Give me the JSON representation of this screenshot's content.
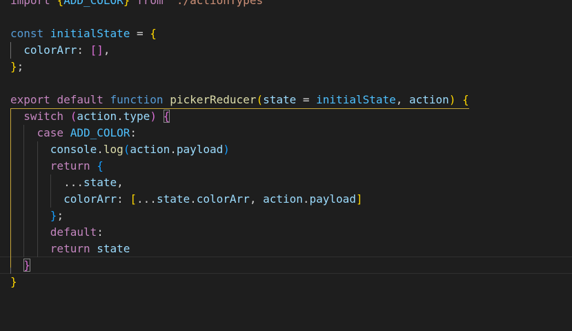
{
  "editor": {
    "colors": {
      "background": "#1e1e1e",
      "keyword_blue": "#569cd6",
      "keyword_purple": "#c586c0",
      "variable": "#9cdcfe",
      "constant": "#4fc1ff",
      "function": "#dcdcaa",
      "string": "#ce9178",
      "bracket_gold": "#ffd700",
      "bracket_orchid": "#da70d6",
      "bracket_blue": "#179fff"
    },
    "lines": [
      {
        "tokens": [
          {
            "t": "import ",
            "c": "kw-purple"
          },
          {
            "t": "{",
            "c": "br1"
          },
          {
            "t": "ADD_COLOR",
            "c": "const"
          },
          {
            "t": "}",
            "c": "br1"
          },
          {
            "t": " from ",
            "c": "kw-purple"
          },
          {
            "t": "'./actionTypes'",
            "c": "str"
          }
        ]
      },
      {
        "tokens": []
      },
      {
        "tokens": [
          {
            "t": "const ",
            "c": "kw-blue"
          },
          {
            "t": "initialState",
            "c": "const"
          },
          {
            "t": " = ",
            "c": "punc"
          },
          {
            "t": "{",
            "c": "br1"
          }
        ]
      },
      {
        "tokens": [
          {
            "t": "  ",
            "c": "punc"
          },
          {
            "t": "colorArr",
            "c": "var"
          },
          {
            "t": ": ",
            "c": "punc"
          },
          {
            "t": "[]",
            "c": "br2"
          },
          {
            "t": ",",
            "c": "punc"
          }
        ]
      },
      {
        "tokens": [
          {
            "t": "}",
            "c": "br1"
          },
          {
            "t": ";",
            "c": "punc"
          }
        ]
      },
      {
        "tokens": []
      },
      {
        "tokens": [
          {
            "t": "export ",
            "c": "kw-purple"
          },
          {
            "t": "default ",
            "c": "kw-purple"
          },
          {
            "t": "function ",
            "c": "kw-blue"
          },
          {
            "t": "pickerReducer",
            "c": "fn"
          },
          {
            "t": "(",
            "c": "br1"
          },
          {
            "t": "state",
            "c": "var"
          },
          {
            "t": " = ",
            "c": "punc"
          },
          {
            "t": "initialState",
            "c": "const"
          },
          {
            "t": ", ",
            "c": "punc"
          },
          {
            "t": "action",
            "c": "var"
          },
          {
            "t": ")",
            "c": "br1"
          },
          {
            "t": " ",
            "c": "punc"
          },
          {
            "t": "{",
            "c": "br1"
          }
        ]
      },
      {
        "tokens": [
          {
            "t": "  ",
            "c": "punc"
          },
          {
            "t": "switch ",
            "c": "kw-purple"
          },
          {
            "t": "(",
            "c": "br2"
          },
          {
            "t": "action",
            "c": "var"
          },
          {
            "t": ".",
            "c": "punc"
          },
          {
            "t": "type",
            "c": "var"
          },
          {
            "t": ")",
            "c": "br2"
          },
          {
            "t": " ",
            "c": "punc"
          },
          {
            "t": "{",
            "c": "br2",
            "match": true
          }
        ]
      },
      {
        "tokens": [
          {
            "t": "    ",
            "c": "punc"
          },
          {
            "t": "case ",
            "c": "kw-purple"
          },
          {
            "t": "ADD_COLOR",
            "c": "const"
          },
          {
            "t": ":",
            "c": "punc"
          }
        ]
      },
      {
        "tokens": [
          {
            "t": "      ",
            "c": "punc"
          },
          {
            "t": "console",
            "c": "var"
          },
          {
            "t": ".",
            "c": "punc"
          },
          {
            "t": "log",
            "c": "fn"
          },
          {
            "t": "(",
            "c": "br3"
          },
          {
            "t": "action",
            "c": "var"
          },
          {
            "t": ".",
            "c": "punc"
          },
          {
            "t": "payload",
            "c": "var"
          },
          {
            "t": ")",
            "c": "br3"
          }
        ]
      },
      {
        "tokens": [
          {
            "t": "      ",
            "c": "punc"
          },
          {
            "t": "return ",
            "c": "kw-purple"
          },
          {
            "t": "{",
            "c": "br3"
          }
        ]
      },
      {
        "tokens": [
          {
            "t": "        ",
            "c": "punc"
          },
          {
            "t": "...",
            "c": "punc"
          },
          {
            "t": "state",
            "c": "var"
          },
          {
            "t": ",",
            "c": "punc"
          }
        ]
      },
      {
        "tokens": [
          {
            "t": "        ",
            "c": "punc"
          },
          {
            "t": "colorArr",
            "c": "var"
          },
          {
            "t": ": ",
            "c": "punc"
          },
          {
            "t": "[",
            "c": "br1"
          },
          {
            "t": "...",
            "c": "punc"
          },
          {
            "t": "state",
            "c": "var"
          },
          {
            "t": ".",
            "c": "punc"
          },
          {
            "t": "colorArr",
            "c": "var"
          },
          {
            "t": ", ",
            "c": "punc"
          },
          {
            "t": "action",
            "c": "var"
          },
          {
            "t": ".",
            "c": "punc"
          },
          {
            "t": "payload",
            "c": "var"
          },
          {
            "t": "]",
            "c": "br1"
          }
        ]
      },
      {
        "tokens": [
          {
            "t": "      ",
            "c": "punc"
          },
          {
            "t": "}",
            "c": "br3"
          },
          {
            "t": ";",
            "c": "punc"
          }
        ]
      },
      {
        "tokens": [
          {
            "t": "      ",
            "c": "punc"
          },
          {
            "t": "default",
            "c": "kw-purple"
          },
          {
            "t": ":",
            "c": "punc"
          }
        ]
      },
      {
        "tokens": [
          {
            "t": "      ",
            "c": "punc"
          },
          {
            "t": "return ",
            "c": "kw-purple"
          },
          {
            "t": "state",
            "c": "var"
          }
        ]
      },
      {
        "tokens": [
          {
            "t": "  ",
            "c": "punc"
          },
          {
            "t": "}",
            "c": "br2",
            "match": true
          }
        ]
      },
      {
        "tokens": [
          {
            "t": "}",
            "c": "br1"
          }
        ]
      }
    ]
  }
}
